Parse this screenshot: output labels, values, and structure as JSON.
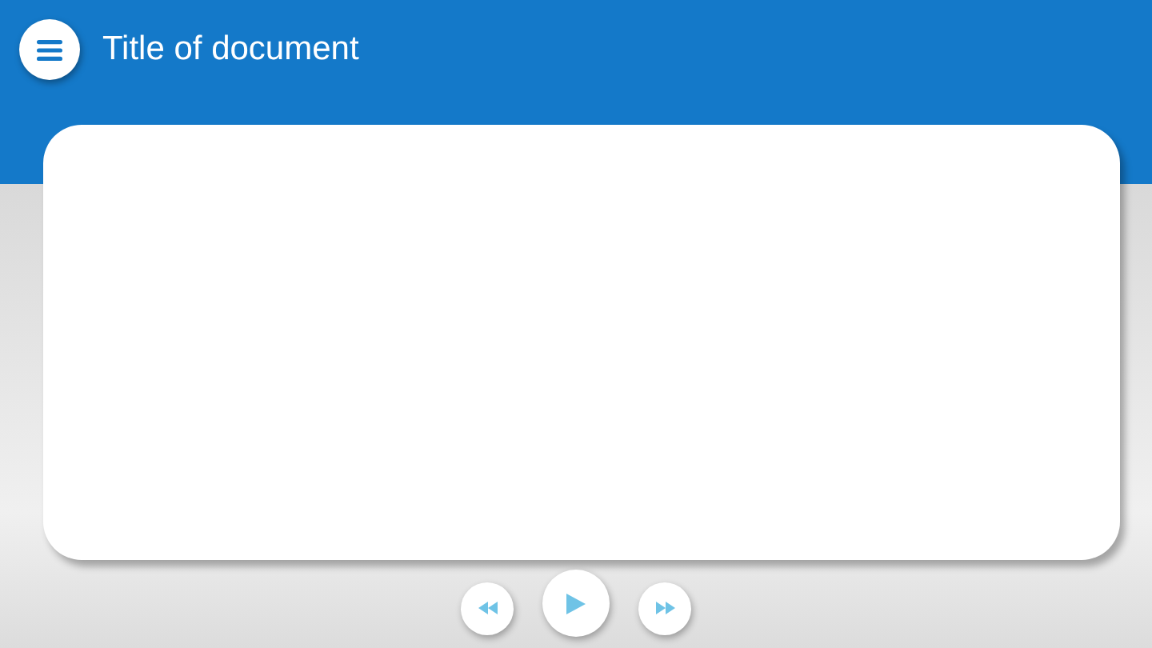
{
  "header": {
    "title": "Title of document"
  },
  "controls": [
    {
      "kind": "rewind"
    },
    {
      "kind": "play"
    },
    {
      "kind": "forward"
    }
  ]
}
